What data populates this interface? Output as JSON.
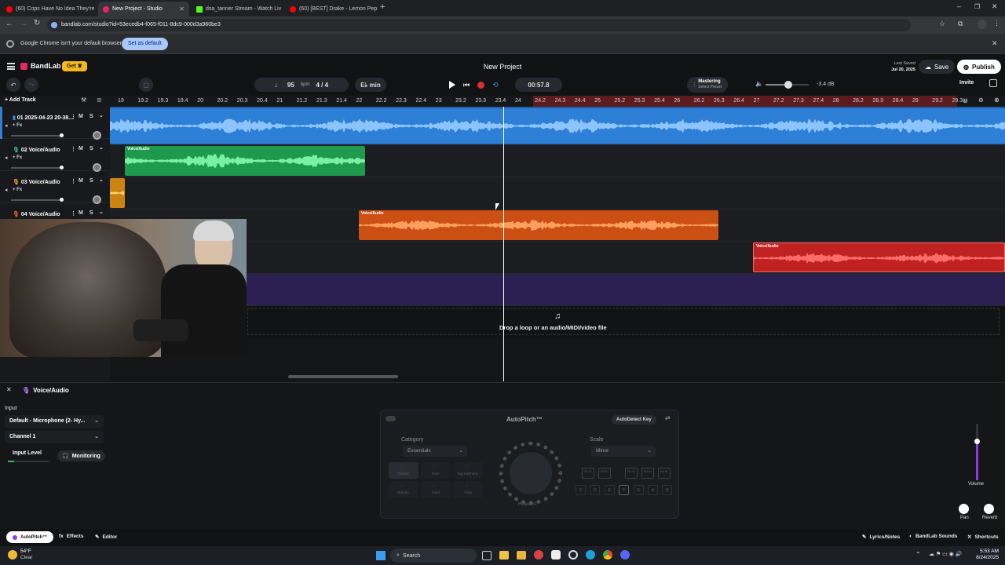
{
  "browser": {
    "tabs": [
      {
        "label": "(60) Cops Have No Idea They're",
        "color": "#ff0000"
      },
      {
        "label": "New Project - Studio",
        "color": "#e8265c"
      },
      {
        "label": "dsa_tanner Stream - Watch Liv",
        "color": "#53fc18"
      },
      {
        "label": "(60) [BEST] Drake - Lemon Pep",
        "color": "#ff0000"
      }
    ],
    "url": "bandlab.com/studio?id=53ecedb4-f065-f011-8dc9-000d3a960be3",
    "infobar_text": "Google Chrome isn't your default browser",
    "infobar_button": "Set as default"
  },
  "app": {
    "logo": "BandLab",
    "get_label": "Get",
    "project_title": "New Project",
    "last_saved_label": "Last Saved",
    "last_saved_date": "Jul 20, 2025",
    "save_label": "Save",
    "publish_label": "Publish",
    "invite_label": "Invite",
    "bpm_value": "95",
    "bpm_unit": "bpm",
    "time_sig": "4 / 4",
    "key_label": "E♭ min",
    "time_display": "00:57.8",
    "mastering_label": "Mastering",
    "mastering_sub": "Select Preset",
    "master_db": "-3.4 dB",
    "add_track": "Add Track"
  },
  "ruler": {
    "ticks": [
      "19",
      "19.2",
      "19.3",
      "19.4",
      "20",
      "20.2",
      "20.3",
      "20.4",
      "21",
      "21.2",
      "21.3",
      "21.4",
      "22",
      "22.2",
      "22.3",
      "22.4",
      "23",
      "23.2",
      "23.3",
      "23.4",
      "24",
      "24.2",
      "24.3",
      "24.4",
      "25",
      "25.2",
      "25.3",
      "25.4",
      "26",
      "26.2",
      "26.3",
      "26.4",
      "27",
      "27.2",
      "27.3",
      "27.4",
      "28",
      "28.2",
      "28.3",
      "28.4",
      "29",
      "29.2",
      "29.3"
    ]
  },
  "tracks": [
    {
      "num": "01",
      "name": "2025-04-23 20-38...",
      "fx": "+ Fx",
      "color": "#3a8ee0"
    },
    {
      "num": "02",
      "name": "Voice/Audio",
      "fx": "+ Fx",
      "color": "#2ec26a"
    },
    {
      "num": "03",
      "name": "Voice/Audio",
      "fx": "+ Fx",
      "color": "#f0a020"
    },
    {
      "num": "04",
      "name": "Voice/Audio",
      "fx": "",
      "color": "#e8621e"
    }
  ],
  "clips": {
    "clip_label": "Voice/Audio"
  },
  "drop_text": "Drop a loop or an audio/MIDI/video file",
  "panel": {
    "title": "Voice/Audio",
    "input_label": "Input",
    "input_device": "Default - Microphone (2- Hy...",
    "channel": "Channel 1",
    "input_level": "Input Level",
    "monitoring": "Monitoring",
    "autopitch_title": "AutoPitch™",
    "autodetect": "AutoDetect Key",
    "category_label": "Category",
    "category_value": "Essentials",
    "scale_label": "Scale",
    "scale_value": "Minor",
    "effects": [
      "Classic",
      "Duet",
      "Big Harmony",
      "Robotic",
      "Hard",
      "Chip"
    ],
    "knob_label": "Heaviest",
    "keys_top": [
      "C♯ D♭",
      "D♯ E♭",
      "F♯ G♭",
      "G♯ A♭",
      "A♯ B♭"
    ],
    "keys_bottom": [
      "C",
      "D",
      "E",
      "F",
      "G",
      "A",
      "B"
    ],
    "volume_label": "Volume",
    "pan_label": "Pan",
    "reverb_label": "Reverb"
  },
  "footer": {
    "autopitch": "AutoPitch™",
    "effects": "Effects",
    "editor": "Editor",
    "lyrics": "Lyrics/Notes",
    "sounds": "BandLab Sounds",
    "shortcuts": "Shortcuts"
  },
  "taskbar": {
    "weather_temp": "54°F",
    "weather_desc": "Clear",
    "search": "Search",
    "time": "5:53 AM",
    "date": "8/24/2025"
  },
  "colors": {
    "track1": "#2e7fd6",
    "track2": "#27b45d",
    "track3": "#e8a21a",
    "track4": "#e05a18",
    "track5": "#d52b2b",
    "track6": "#3d2a6e",
    "record": "#e02b2b",
    "accent": "#f5b81c"
  }
}
